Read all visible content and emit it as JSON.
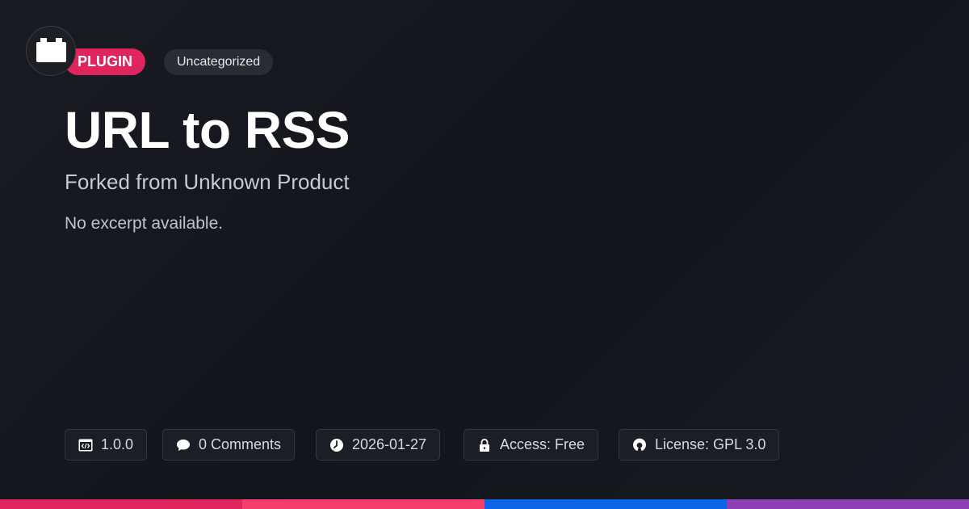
{
  "header": {
    "type_badge": "PLUGIN",
    "category_badge": "Uncategorized"
  },
  "main": {
    "title": "URL to RSS",
    "subtitle": "Forked from Unknown Product",
    "excerpt": "No excerpt available."
  },
  "meta": {
    "version": "1.0.0",
    "comments": "0 Comments",
    "date": "2026-01-27",
    "access": "Access: Free",
    "license": "License: GPL 3.0"
  },
  "icons": {
    "logo": "plugin-block-icon",
    "version": "code-window-icon",
    "comments": "speech-bubble-icon",
    "date": "clock-icon",
    "access": "lock-icon",
    "license": "open-source-icon"
  },
  "colors": {
    "accent": "#e0245e",
    "background": "#15171d",
    "bar": [
      "#e0245e",
      "#f43f6c",
      "#0b63e5",
      "#8e3fb5"
    ]
  }
}
